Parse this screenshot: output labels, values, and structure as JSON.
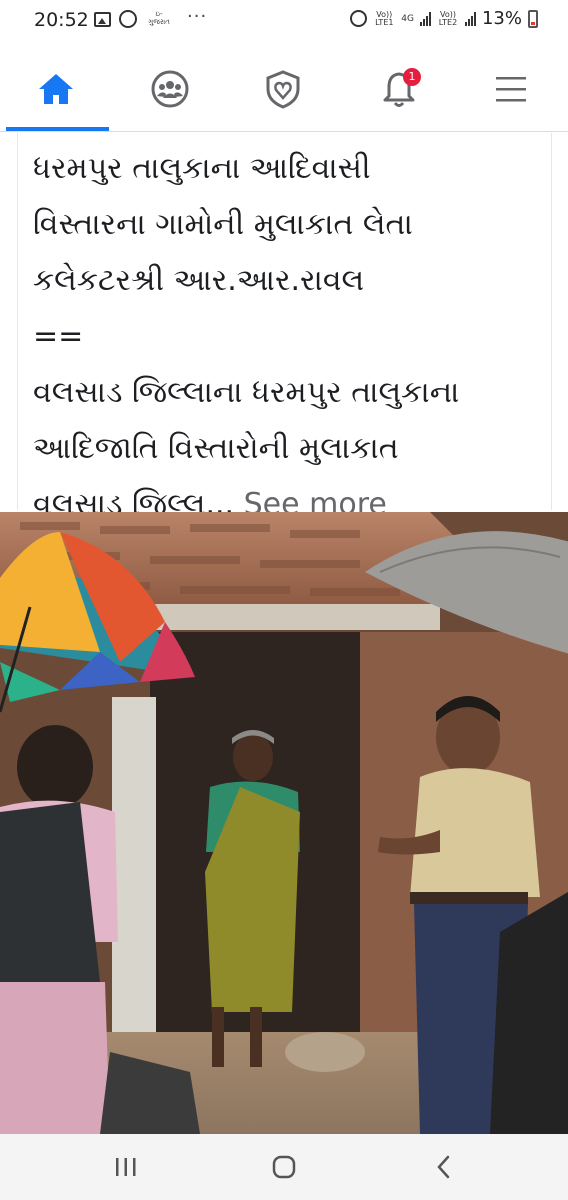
{
  "status_bar": {
    "time": "20:52",
    "app_label": "ઇ-ગુજરાત",
    "overflow": "···",
    "sim1_label": "Vo)) LTE1",
    "net_label": "4G",
    "sim2_label": "Vo)) LTE2",
    "battery": "13%"
  },
  "nav": {
    "items": [
      {
        "name": "home",
        "active": true
      },
      {
        "name": "groups",
        "active": false
      },
      {
        "name": "dating",
        "active": false
      },
      {
        "name": "notifications",
        "active": false
      },
      {
        "name": "menu",
        "active": false
      }
    ],
    "notification_badge": "1",
    "accent_color": "#1877f2"
  },
  "post": {
    "lines": [
      "ધરમપુર તાલુકાના આદિવાસી",
      "વિસ્તારના ગામોની મુલાકાત લેતા",
      "કલેકટરશ્રી આર.આર.રાવલ",
      "==",
      "વલસાડ જિલ્લાના ધરમપુર તાલુકાના",
      "આદિજાતિ વિસ્તારોની મુલાકાત",
      "વલસાડ જિલ્લ..."
    ],
    "see_more": "See more"
  },
  "system_nav": {
    "recent_icon": "recent-apps-icon",
    "home_icon": "home-circle-icon",
    "back_icon": "back-chevron-icon"
  }
}
